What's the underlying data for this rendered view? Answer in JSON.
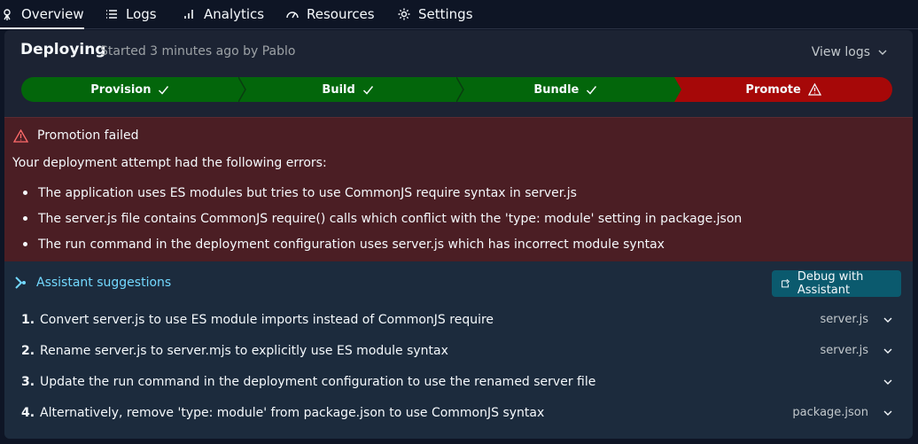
{
  "nav": {
    "tabs": [
      {
        "label": "Overview",
        "icon": "ray-icon",
        "active": true
      },
      {
        "label": "Logs",
        "icon": "list-icon",
        "active": false
      },
      {
        "label": "Analytics",
        "icon": "bar-chart-icon",
        "active": false
      },
      {
        "label": "Resources",
        "icon": "gauge-icon",
        "active": false
      },
      {
        "label": "Settings",
        "icon": "gear-icon",
        "active": false
      }
    ]
  },
  "deploy": {
    "title": "Deploying",
    "subtitle": "Started 3 minutes ago by Pablo",
    "view_logs": "View logs",
    "steps": [
      {
        "label": "Provision",
        "status": "success"
      },
      {
        "label": "Build",
        "status": "success"
      },
      {
        "label": "Bundle",
        "status": "success"
      },
      {
        "label": "Promote",
        "status": "failed"
      }
    ]
  },
  "error": {
    "title": "Promotion failed",
    "description": "Your deployment attempt had the following errors:",
    "items": [
      "The application uses ES modules but tries to use CommonJS require syntax in server.js",
      "The server.js file contains CommonJS require() calls which conflict with the 'type: module' setting in package.json",
      "The run command in the deployment configuration uses server.js which has incorrect module syntax"
    ]
  },
  "assistant": {
    "title": "Assistant suggestions",
    "debug_button": "Debug with Assistant",
    "suggestions": [
      {
        "num": "1.",
        "text": "Convert server.js to use ES module imports instead of CommonJS require",
        "file": "server.js"
      },
      {
        "num": "2.",
        "text": "Rename server.js to server.mjs to explicitly use ES module syntax",
        "file": "server.js"
      },
      {
        "num": "3.",
        "text": "Update the run command in the deployment configuration to use the renamed server file",
        "file": ""
      },
      {
        "num": "4.",
        "text": "Alternatively, remove 'type: module' from package.json to use CommonJS syntax",
        "file": "package.json"
      }
    ]
  },
  "colors": {
    "success": "#03660b",
    "failed": "#a60808",
    "error_bg": "#4b1e24",
    "accent": "#73d9ff"
  }
}
